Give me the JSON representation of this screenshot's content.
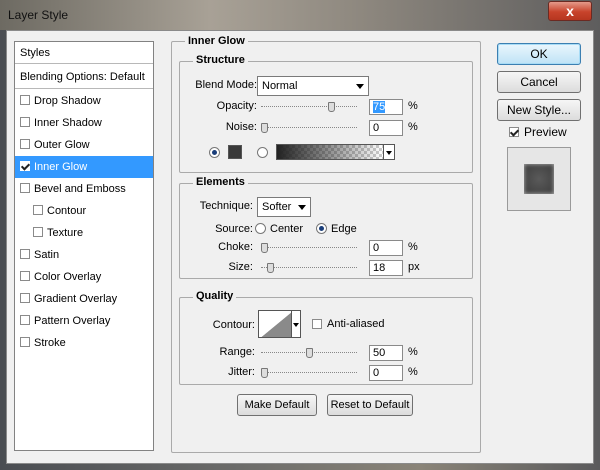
{
  "window": {
    "title": "Layer Style",
    "close_label": "x"
  },
  "sidebar": {
    "header": "Styles",
    "blending": "Blending Options: Default",
    "items": [
      {
        "label": "Drop Shadow",
        "checked": false
      },
      {
        "label": "Inner Shadow",
        "checked": false
      },
      {
        "label": "Outer Glow",
        "checked": false
      },
      {
        "label": "Inner Glow",
        "checked": true,
        "selected": true
      },
      {
        "label": "Bevel and Emboss",
        "checked": false
      },
      {
        "label": "Contour",
        "checked": false,
        "sub": true
      },
      {
        "label": "Texture",
        "checked": false,
        "sub": true
      },
      {
        "label": "Satin",
        "checked": false
      },
      {
        "label": "Color Overlay",
        "checked": false
      },
      {
        "label": "Gradient Overlay",
        "checked": false
      },
      {
        "label": "Pattern Overlay",
        "checked": false
      },
      {
        "label": "Stroke",
        "checked": false
      }
    ]
  },
  "panel": {
    "title": "Inner Glow",
    "structure": {
      "title": "Structure",
      "blend_mode_label": "Blend Mode:",
      "blend_mode": "Normal",
      "opacity_label": "Opacity:",
      "opacity": "75",
      "opacity_unit": "%",
      "opacity_fraction": 0.75,
      "noise_label": "Noise:",
      "noise": "0",
      "noise_unit": "%",
      "noise_fraction": 0.0,
      "glow_color": "#3a3a3a"
    },
    "elements": {
      "title": "Elements",
      "technique_label": "Technique:",
      "technique": "Softer",
      "source_label": "Source:",
      "source_center": "Center",
      "source_edge": "Edge",
      "choke_label": "Choke:",
      "choke": "0",
      "choke_unit": "%",
      "choke_fraction": 0.0,
      "size_label": "Size:",
      "size": "18",
      "size_unit": "px",
      "size_fraction": 0.07
    },
    "quality": {
      "title": "Quality",
      "contour_label": "Contour:",
      "anti_aliased": "Anti-aliased",
      "range_label": "Range:",
      "range": "50",
      "range_unit": "%",
      "range_fraction": 0.5,
      "jitter_label": "Jitter:",
      "jitter": "0",
      "jitter_unit": "%",
      "jitter_fraction": 0.0
    },
    "make_default": "Make Default",
    "reset_default": "Reset to Default"
  },
  "right": {
    "ok": "OK",
    "cancel": "Cancel",
    "new_style": "New Style...",
    "preview_label": "Preview",
    "preview_checked": true
  }
}
